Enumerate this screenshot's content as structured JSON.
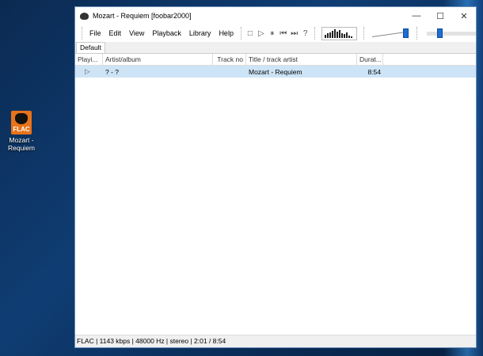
{
  "desktop": {
    "icon_label": "Mozart - Requiem",
    "icon_badge": "FLAC"
  },
  "window": {
    "title": "Mozart - Requiem  [foobar2000]",
    "controls": {
      "minimize": "—",
      "maximize": "☐",
      "close": "✕"
    }
  },
  "menu": [
    "File",
    "Edit",
    "View",
    "Playback",
    "Library",
    "Help"
  ],
  "toolbar": {
    "stop": "□",
    "play": "▷",
    "pause": "⏸",
    "prev": "⏮",
    "next": "⏭",
    "random": "?"
  },
  "volume_level": 1.0,
  "seek_position": 0.23,
  "tabs": [
    "Default"
  ],
  "columns": [
    "Playi...",
    "Artist/album",
    "Track no",
    "Title / track artist",
    "Durat..."
  ],
  "rows": [
    {
      "playing": "▷",
      "artist_album": "? - ?",
      "track_no": "",
      "title": "Mozart - Requiem",
      "duration": "8:54"
    }
  ],
  "status": "FLAC | 1143 kbps | 48000 Hz | stereo | 2:01 / 8:54"
}
